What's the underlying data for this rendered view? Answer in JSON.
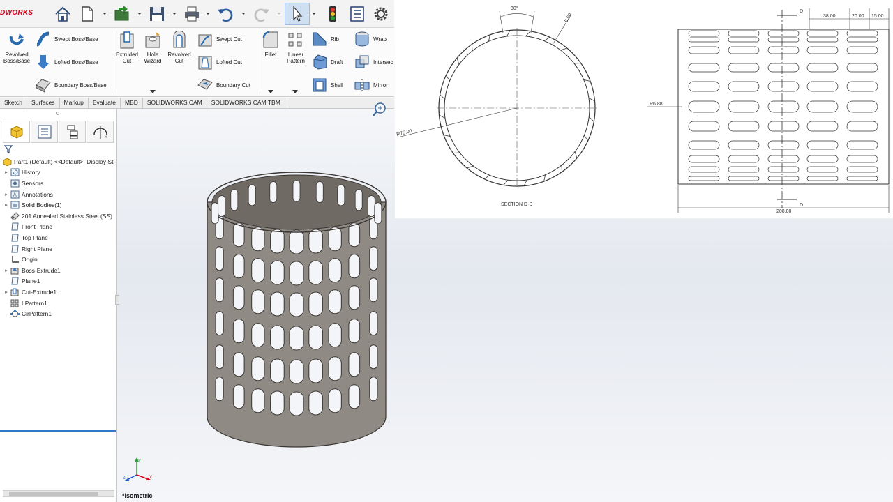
{
  "app": {
    "logo_text": "DWORKS",
    "brand_color": "#d0021b"
  },
  "quick_access": [
    {
      "name": "home-icon"
    },
    {
      "name": "new-document-icon"
    },
    {
      "name": "open-icon"
    },
    {
      "name": "save-icon"
    },
    {
      "name": "print-icon"
    },
    {
      "name": "undo-icon"
    },
    {
      "name": "redo-icon"
    },
    {
      "name": "select-arrow-icon"
    },
    {
      "name": "rebuild-traffic-light-icon"
    },
    {
      "name": "file-properties-icon"
    },
    {
      "name": "options-gear-icon"
    }
  ],
  "ribbon": {
    "revolved_boss": "Revolved Boss/Base",
    "swept_boss": "Swept Boss/Base",
    "lofted_boss": "Lofted Boss/Base",
    "boundary_boss": "Boundary Boss/Base",
    "extruded_cut": "Extruded Cut",
    "hole_wizard": "Hole Wizard",
    "revolved_cut": "Revolved Cut",
    "swept_cut": "Swept Cut",
    "lofted_cut": "Lofted Cut",
    "boundary_cut": "Boundary Cut",
    "fillet": "Fillet",
    "linear_pattern": "Linear Pattern",
    "rib": "Rib",
    "draft": "Draft",
    "shell": "Shell",
    "wrap": "Wrap",
    "intersect": "Intersec",
    "mirror": "Mirror"
  },
  "tabs": [
    "Sketch",
    "Surfaces",
    "Markup",
    "Evaluate",
    "MBD",
    "SOLIDWORKS CAM",
    "SOLIDWORKS CAM TBM"
  ],
  "tree": {
    "root": "Part1 (Default) <<Default>_Display Sta",
    "items": [
      {
        "label": "History",
        "expandable": true,
        "icon": "history-icon"
      },
      {
        "label": "Sensors",
        "expandable": false,
        "icon": "sensors-icon"
      },
      {
        "label": "Annotations",
        "expandable": true,
        "icon": "annotations-icon"
      },
      {
        "label": "Solid Bodies(1)",
        "expandable": true,
        "icon": "solid-bodies-icon"
      },
      {
        "label": "201 Annealed Stainless Steel (SS)",
        "expandable": false,
        "icon": "material-icon"
      },
      {
        "label": "Front Plane",
        "expandable": false,
        "icon": "plane-icon"
      },
      {
        "label": "Top Plane",
        "expandable": false,
        "icon": "plane-icon"
      },
      {
        "label": "Right Plane",
        "expandable": false,
        "icon": "plane-icon"
      },
      {
        "label": "Origin",
        "expandable": false,
        "icon": "origin-icon"
      },
      {
        "label": "Boss-Extrude1",
        "expandable": true,
        "icon": "boss-extrude-icon"
      },
      {
        "label": "Plane1",
        "expandable": false,
        "icon": "plane-icon"
      },
      {
        "label": "Cut-Extrude1",
        "expandable": true,
        "icon": "cut-extrude-icon"
      },
      {
        "label": "LPattern1",
        "expandable": false,
        "icon": "linear-pattern-icon"
      },
      {
        "label": "CirPattern1",
        "expandable": false,
        "icon": "circular-pattern-icon"
      }
    ]
  },
  "drawing": {
    "section_label": "SECTION D-D",
    "angle_dim": "30°",
    "thickness_dim": "5.00",
    "radius_dim": "R75.00",
    "slot_radius_dim": "R6.88",
    "width_dim": "200.00",
    "dim_38": "38.00",
    "dim_20": "20.00",
    "dim_15": "15.00",
    "section_marker": "D"
  },
  "viewport": {
    "view_name": "*Isometric",
    "model_color": "#8f8a84"
  }
}
